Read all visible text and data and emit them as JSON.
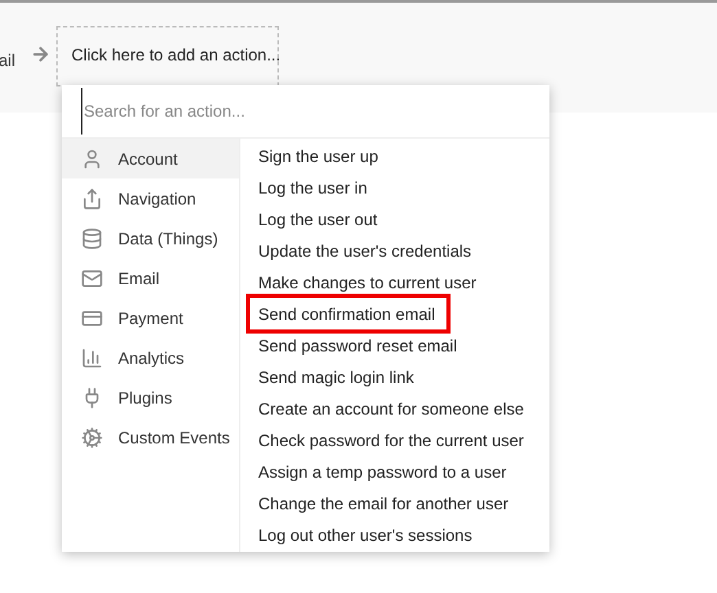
{
  "workflow": {
    "previous_step": "ail",
    "add_action": "Click here to add an action..."
  },
  "dropdown": {
    "search": {
      "placeholder": "Search for an action..."
    },
    "categories": [
      {
        "label": "Account",
        "selected": true
      },
      {
        "label": "Navigation",
        "selected": false
      },
      {
        "label": "Data (Things)",
        "selected": false
      },
      {
        "label": "Email",
        "selected": false
      },
      {
        "label": "Payment",
        "selected": false
      },
      {
        "label": "Analytics",
        "selected": false
      },
      {
        "label": "Plugins",
        "selected": false
      },
      {
        "label": "Custom Events",
        "selected": false
      }
    ],
    "actions": [
      {
        "label": "Sign the user up",
        "highlighted": false
      },
      {
        "label": "Log the user in",
        "highlighted": false
      },
      {
        "label": "Log the user out",
        "highlighted": false
      },
      {
        "label": "Update the user's credentials",
        "highlighted": false
      },
      {
        "label": "Make changes to current user",
        "highlighted": false
      },
      {
        "label": "Send confirmation email",
        "highlighted": true
      },
      {
        "label": "Send password reset email",
        "highlighted": false
      },
      {
        "label": "Send magic login link",
        "highlighted": false
      },
      {
        "label": "Create an account for someone else",
        "highlighted": false
      },
      {
        "label": "Check password for the current user",
        "highlighted": false
      },
      {
        "label": "Assign a temp password to a user",
        "highlighted": false
      },
      {
        "label": "Change the email for another user",
        "highlighted": false
      },
      {
        "label": "Log out other user's sessions",
        "highlighted": false
      }
    ]
  }
}
